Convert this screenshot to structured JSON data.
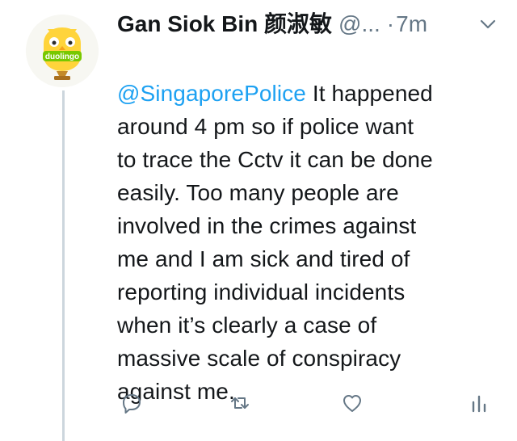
{
  "tweet": {
    "display_name": "Gan Siok Bin 颜淑敏",
    "handle": "@...",
    "separator": "·",
    "time": "7m",
    "mention": "@SingaporePolice",
    "text_lines": [
      " It happened",
      "around 4 pm so if police want",
      "to trace the Cctv it can be done",
      "easily. Too many people are",
      "involved in the crimes against",
      "me and I am sick and tired of",
      "reporting individual incidents",
      "when it’s clearly a case of",
      "massive scale of conspiracy",
      "against me."
    ]
  },
  "avatar": {
    "logo_text": "duolingo",
    "icon": "duolingo-owl-trophy-icon"
  },
  "actions": {
    "icons": [
      "reply-icon",
      "retweet-icon",
      "like-icon",
      "analytics-icon"
    ]
  },
  "colors": {
    "text": "#14171a",
    "secondary": "#657786",
    "link": "#1da1f2",
    "thread_line": "#ccd6dd",
    "duolingo_green": "#78c800",
    "trophy_gold": "#c48a2a"
  }
}
